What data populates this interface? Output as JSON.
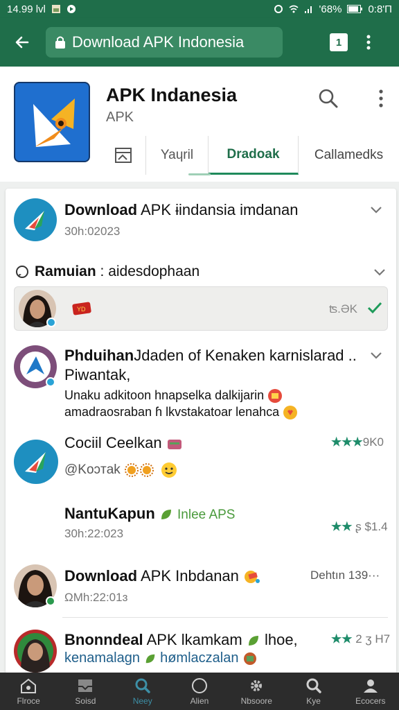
{
  "status_bar": {
    "time": "14.99 lvl",
    "battery": "'68%",
    "clock_right": "0:8'Π",
    "icons": [
      "image-icon",
      "circle-icon",
      "sync-icon",
      "wifi-icon",
      "signal-icon",
      "battery-icon"
    ]
  },
  "app_bar": {
    "url_text": "Download APK Indonesia",
    "tab_count": "1",
    "icons": [
      "back-arrow-icon",
      "lock-icon",
      "menu-dots-icon"
    ]
  },
  "header": {
    "title": "APK Indanesia",
    "subtitle": "APK",
    "tabs": [
      "Yaɥril",
      "Dradoak",
      "Callamedks"
    ],
    "active_tab": "Dradoak"
  },
  "feed": [
    {
      "title_bold": "Download",
      "title_rest": " APK ɨindansia imdanan",
      "meta": "30h:02023"
    },
    {
      "section_label_bold": "Ramuian",
      "section_label_rest": " : aidesdophaan",
      "highlight_status": "ʦ.ƏK"
    },
    {
      "title_bold": "Phduihan",
      "title_rest": "Jdaden of Kenaken karnislarad ..",
      "title_line2": "Piwantak,",
      "body_line1": "Unaku adkitoon hnapselka dalkijarin",
      "body_line2": "amadraosraban ɦ lkvstakatoar lenahca"
    },
    {
      "title": "Cociil Ceelkan",
      "meta": "@Koɔтak",
      "rating": "★★★",
      "rating_value": "9K0"
    },
    {
      "title_bold": "NantuKapun",
      "tag": "Inlee APS",
      "meta": "30h:22:023",
      "rating": "★★",
      "rating_value": "ʂ $1.4"
    },
    {
      "title_bold": "Download",
      "title_rest": " APK Inbdanan",
      "meta": "ΩMh:22:01ɜ",
      "right_text": "Dehtın 139···"
    },
    {
      "title_bold": "Bnonndeal",
      "title_rest": " APK lkamkam",
      "title_tail": " lhoe,",
      "line2_a": "kenamalagn",
      "line2_b": " hømlaczalan",
      "rating": "★★",
      "rating_value": "2 ʒ H7"
    }
  ],
  "bottom_nav": [
    "Flroce",
    "Soisd",
    "Neey",
    "Alien",
    "Nbsoore",
    "Kye",
    "Ecocers"
  ],
  "colors": {
    "primary": "#1f6e4a",
    "accent": "#1f8a5b",
    "url_bar": "#3a8a64",
    "nav_bg": "#2c2c2c",
    "nav_active": "#3d8fa6",
    "stars": "#1e8c6a"
  }
}
